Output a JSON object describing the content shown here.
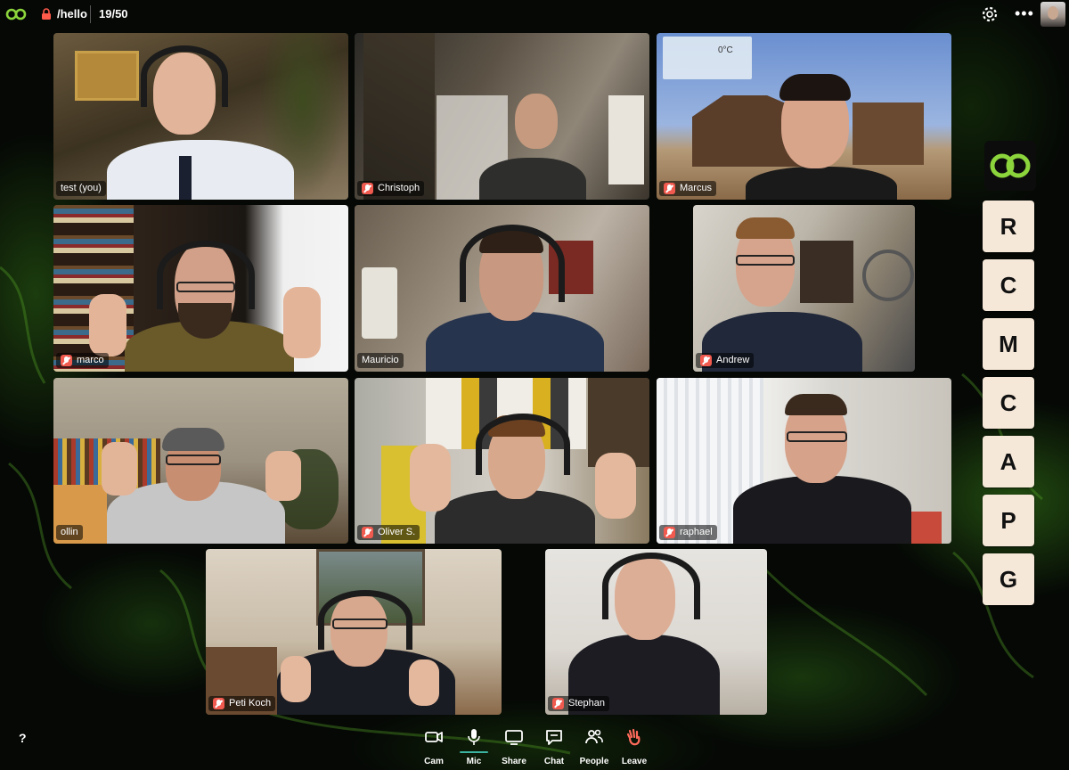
{
  "topbar": {
    "room": "/hello",
    "count": "19/50"
  },
  "participants": [
    {
      "name": "test (you)",
      "muted": false
    },
    {
      "name": "Christoph",
      "muted": true
    },
    {
      "name": "Marcus",
      "muted": true
    },
    {
      "name": "marco",
      "muted": true
    },
    {
      "name": "Mauricio",
      "muted": false
    },
    {
      "name": "Andrew",
      "muted": true
    },
    {
      "name": "ollin",
      "muted": false
    },
    {
      "name": "Oliver S.",
      "muted": true
    },
    {
      "name": "raphael",
      "muted": true
    },
    {
      "name": "Peti Koch",
      "muted": true
    },
    {
      "name": "Stephan",
      "muted": true
    }
  ],
  "weather_widget": {
    "temperature": "0°C"
  },
  "side_letters": [
    "R",
    "C",
    "M",
    "C",
    "A",
    "P",
    "G"
  ],
  "toolbar": {
    "help": "?",
    "cam": "Cam",
    "mic": "Mic",
    "share": "Share",
    "chat": "Chat",
    "people": "People",
    "leave": "Leave"
  },
  "colors": {
    "accent_green": "#8cd43c",
    "mute_red": "#f05a4f",
    "leave_red": "#ff6b5b",
    "mic_active": "#3bb3a0",
    "letter_tile": "#f6e8d8"
  }
}
